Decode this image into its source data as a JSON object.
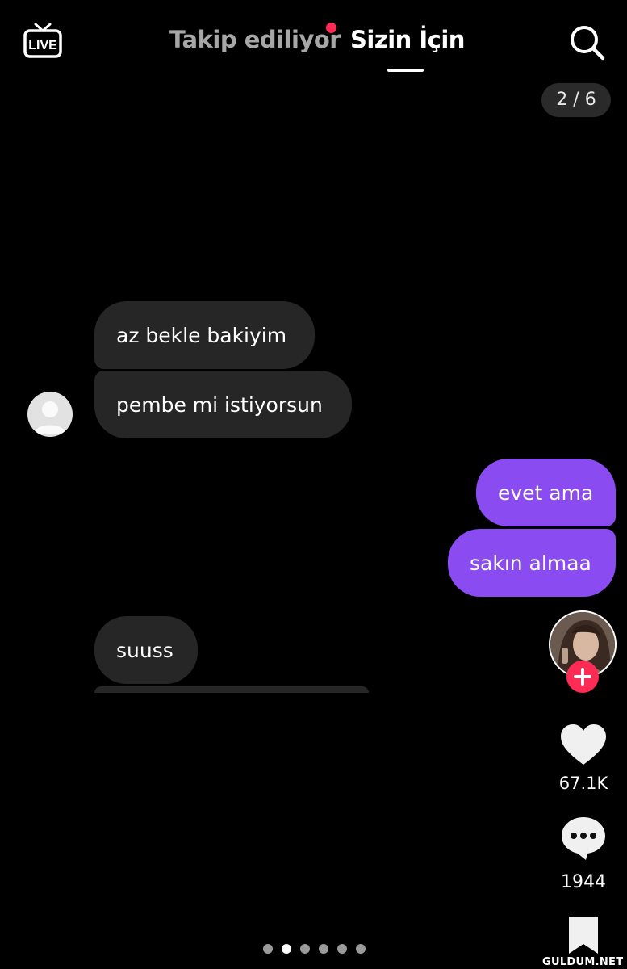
{
  "header": {
    "live_icon": "live-tv-icon",
    "live_label": "LIVE",
    "tabs": [
      {
        "label": "Takip ediliyor",
        "active": false,
        "has_notification_dot": true
      },
      {
        "label": "Sizin İçin",
        "active": true
      }
    ],
    "search_icon": "search-icon"
  },
  "page_counter": "2 / 6",
  "chat": {
    "incoming_color": "#262626",
    "outgoing_color": "#8a4cf0",
    "messages": [
      {
        "text": "az bekle bakiyim",
        "direction": "incoming"
      },
      {
        "text": "pembe mi istiyorsun",
        "direction": "incoming"
      },
      {
        "text": "evet ama",
        "direction": "outgoing"
      },
      {
        "text": "sakın almaa",
        "direction": "outgoing"
      },
      {
        "text": "suuss",
        "direction": "incoming"
      }
    ]
  },
  "actions": {
    "follow_icon": "plus-icon",
    "like_icon": "heart-icon",
    "like_count": "67.1K",
    "comment_icon": "comment-icon",
    "comment_count": "1944",
    "bookmark_icon": "bookmark-icon"
  },
  "carousel": {
    "total": 6,
    "active_index": 1
  },
  "watermark": "GULDUM.NET",
  "colors": {
    "accent": "#fe2c55",
    "background": "#000000"
  }
}
